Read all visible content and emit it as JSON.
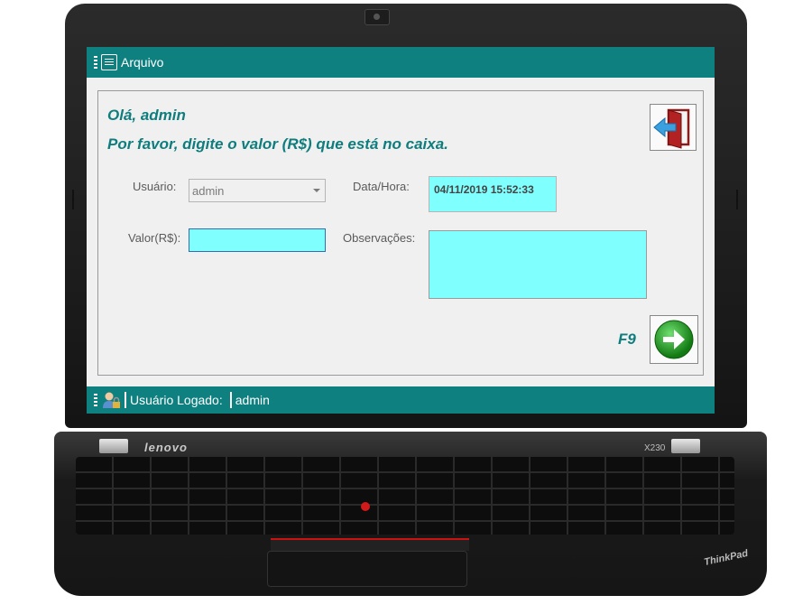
{
  "menubar": {
    "file_label": "Arquivo"
  },
  "greeting": {
    "line1": "Olá,  admin",
    "line2": "Por favor, digite o valor (R$) que está no caixa."
  },
  "form": {
    "usuario_label": "Usuário:",
    "usuario_value": "admin",
    "datahora_label": "Data/Hora:",
    "datahora_value": "04/11/2019  15:52:33",
    "valor_label": "Valor(R$):",
    "valor_value": "",
    "observacoes_label": "Observações:",
    "observacoes_value": ""
  },
  "shortcut": {
    "confirm_key": "F9"
  },
  "statusbar": {
    "logged_label": "Usuário Logado:",
    "logged_user": "admin"
  },
  "laptop": {
    "logo": "lenovo",
    "model": "X230",
    "brand": "ThinkPad"
  },
  "colors": {
    "teal_bar": "#0e8080",
    "input_cyan": "#80ffff",
    "heading_teal": "#0f7d7d",
    "trackpoint_red": "#d31a1a"
  }
}
